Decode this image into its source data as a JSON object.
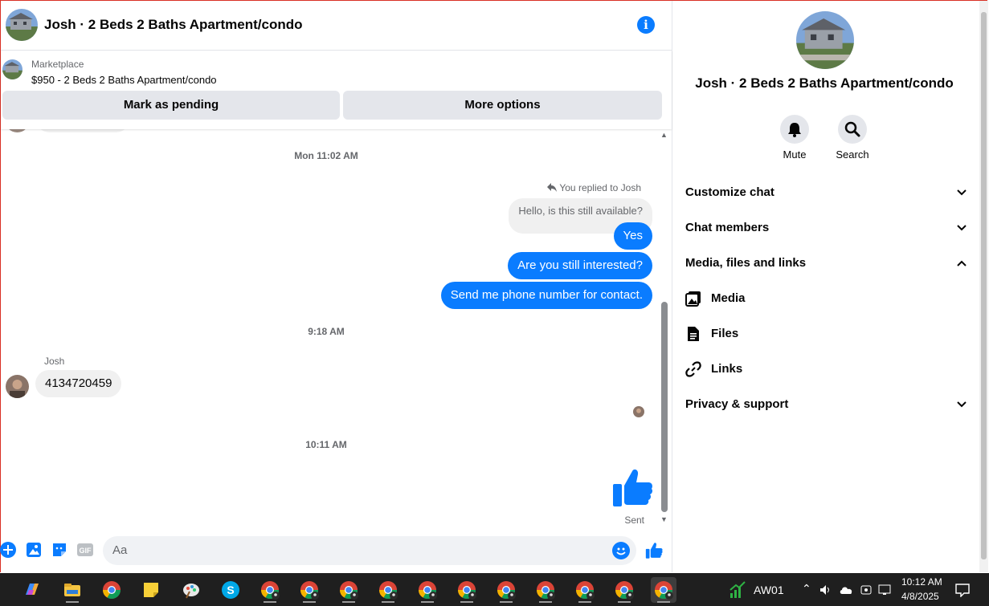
{
  "header": {
    "title": "Josh · 2 Beds 2 Baths Apartment/condo"
  },
  "marketplace": {
    "label": "Marketplace",
    "listing": "$950 - 2 Beds 2 Baths Apartment/condo",
    "pending_button": "Mark as pending",
    "more_button": "More options"
  },
  "messages": {
    "ts1": "Mon 11:02 AM",
    "reply_note": "You replied to Josh",
    "reply_quote": "Hello, is this still available?",
    "out1": "Yes",
    "out2": "Are you still interested?",
    "out3": "Send me phone number for contact.",
    "ts2": "9:18 AM",
    "sender": "Josh",
    "in1": "4134720459",
    "ts3": "10:11 AM",
    "sent": "Sent"
  },
  "composer": {
    "placeholder": "Aa"
  },
  "panel": {
    "title": "Josh · 2 Beds 2 Baths Apartment/condo",
    "mute": "Mute",
    "search": "Search",
    "customize": "Customize chat",
    "members": "Chat members",
    "media_files": "Media, files and links",
    "media": "Media",
    "files": "Files",
    "links": "Links",
    "privacy": "Privacy & support"
  },
  "taskbar": {
    "tray_label": "AW01",
    "time": "10:12 AM",
    "date": "4/8/2025"
  },
  "colors": {
    "accent": "#0a7cff",
    "bubble_in": "#f0f0f0",
    "button_bg": "#e4e6eb"
  }
}
